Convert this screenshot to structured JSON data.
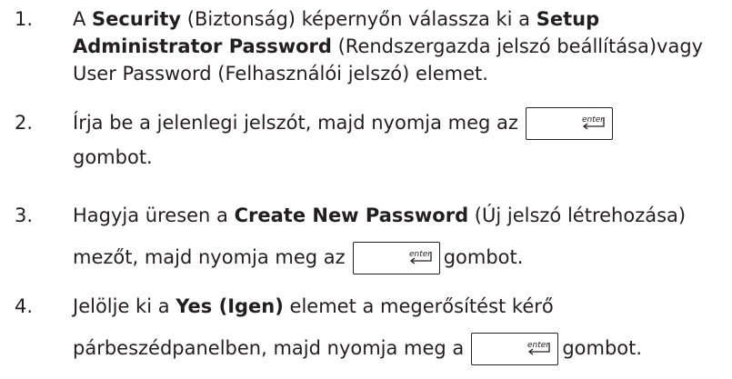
{
  "steps": [
    {
      "number": "1.",
      "line1": {
        "p1": "A ",
        "b1": "Security",
        "p2": " (Biztonság) képernyőn válassza ki a ",
        "b2": "Setup"
      },
      "line2": {
        "b1": "Administrator Password",
        "p1": " (Rendszergazda jelszó beállítása)vagy"
      },
      "line3": "User Password (Felhasználói jelszó) elemet."
    },
    {
      "number": "2.",
      "line1": "Írja be a jelenlegi jelszót, majd nyomja meg az",
      "line2": "gombot."
    },
    {
      "number": "3.",
      "line1": {
        "p1": "Hagyja üresen a ",
        "b1": "Create New Password",
        "p2": " (Új jelszó létrehozása)"
      },
      "line2": {
        "p1": "mezőt, majd nyomja meg az",
        "p2": "gombot."
      }
    },
    {
      "number": "4.",
      "line1": {
        "p1": "Jelölje ki a ",
        "b1": "Yes (Igen)",
        "p2": " elemet a megerősítést kérő"
      },
      "line2": {
        "p1": "párbeszédpanelben, majd nyomja meg a",
        "p2": "gombot."
      }
    }
  ],
  "key_label": "enter"
}
